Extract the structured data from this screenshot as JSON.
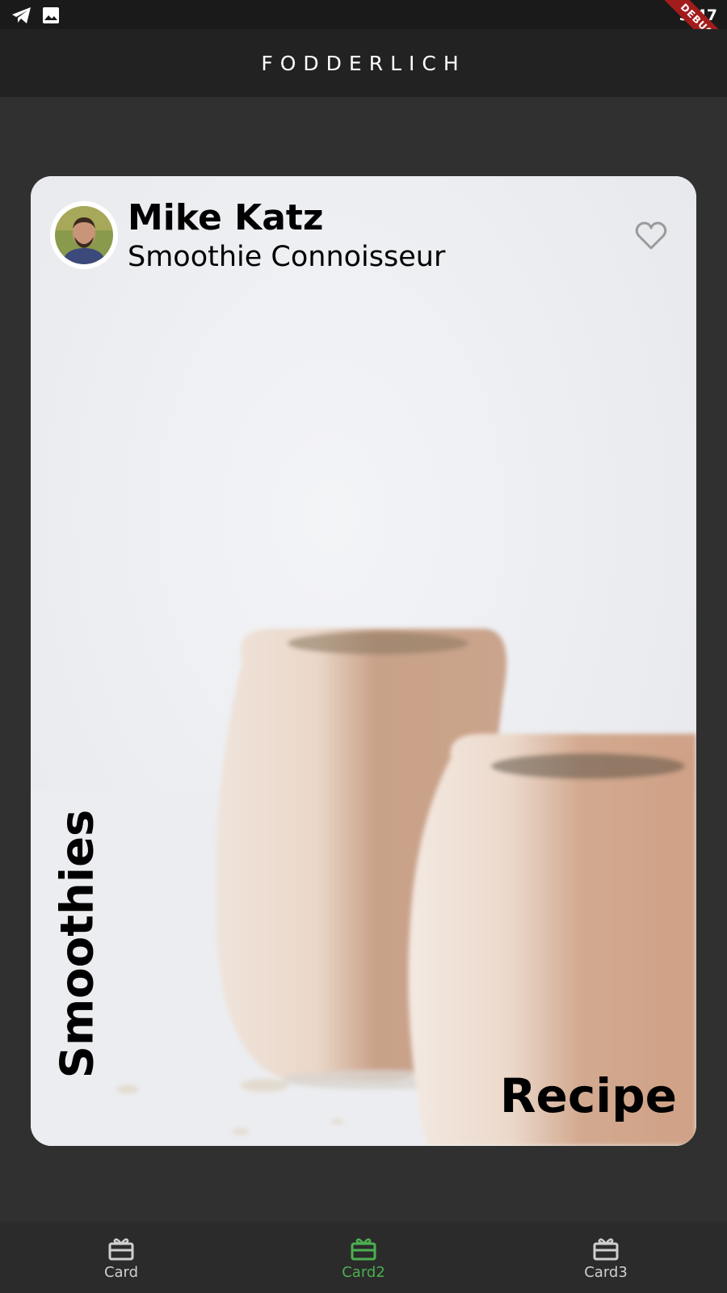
{
  "status_bar": {
    "time": "3:47",
    "icons": [
      "telegram-icon",
      "image-icon"
    ],
    "debug_label": "DEBUG"
  },
  "app_bar": {
    "title": "FODDERLICH"
  },
  "card": {
    "author_name": "Mike Katz",
    "author_title": "Smoothie Connoisseur",
    "side_label": "Smoothies",
    "corner_label": "Recipe",
    "favorite_icon": "heart-outline-icon"
  },
  "bottom_nav": {
    "items": [
      {
        "label": "Card",
        "icon": "card-icon",
        "active": false
      },
      {
        "label": "Card2",
        "icon": "card-icon",
        "active": true
      },
      {
        "label": "Card3",
        "icon": "card-icon",
        "active": false
      }
    ],
    "colors": {
      "active": "#4caf50",
      "inactive": "#cfcfcf"
    }
  }
}
